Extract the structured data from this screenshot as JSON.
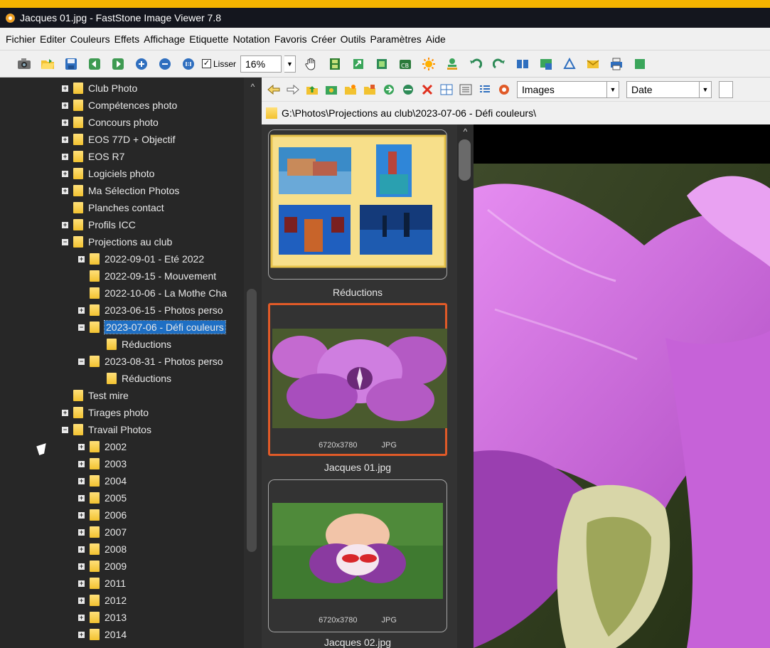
{
  "window": {
    "title": "Jacques 01.jpg  -  FastStone Image Viewer 7.8"
  },
  "menu": [
    "Fichier",
    "Editer",
    "Couleurs",
    "Effets",
    "Affichage",
    "Etiquette",
    "Notation",
    "Favoris",
    "Créer",
    "Outils",
    "Paramètres",
    "Aide"
  ],
  "toolbar": {
    "smooth_label": "Lisser",
    "smooth_checked": "✓",
    "zoom_value": "16%"
  },
  "tree": {
    "items": [
      {
        "label": "Club Photo"
      },
      {
        "label": "Compétences photo"
      },
      {
        "label": "Concours photo"
      },
      {
        "label": "EOS 77D + Objectif"
      },
      {
        "label": "EOS R7"
      },
      {
        "label": "Logiciels photo"
      },
      {
        "label": "Ma Sélection Photos"
      },
      {
        "label": "Planches contact"
      },
      {
        "label": "Profils ICC"
      },
      {
        "label": "Projections au club"
      },
      {
        "label": "2022-09-01 - Eté 2022"
      },
      {
        "label": "2022-09-15 - Mouvement"
      },
      {
        "label": "2022-10-06 - La Mothe Cha"
      },
      {
        "label": "2023-06-15 - Photos perso"
      },
      {
        "label": "2023-07-06 - Défi couleurs"
      },
      {
        "label": "Réductions"
      },
      {
        "label": "2023-08-31 - Photos perso"
      },
      {
        "label": "Réductions"
      },
      {
        "label": "Test mire"
      },
      {
        "label": "Tirages photo"
      },
      {
        "label": "Travail Photos"
      },
      {
        "label": "2002"
      },
      {
        "label": "2003"
      },
      {
        "label": "2004"
      },
      {
        "label": "2005"
      },
      {
        "label": "2006"
      },
      {
        "label": "2007"
      },
      {
        "label": "2008"
      },
      {
        "label": "2009"
      },
      {
        "label": "2011"
      },
      {
        "label": "2012"
      },
      {
        "label": "2013"
      },
      {
        "label": "2014"
      }
    ]
  },
  "browser": {
    "filter_value": "Images",
    "sort_value": "Date",
    "path": "G:\\Photos\\Projections au club\\2023-07-06 - Défi couleurs\\"
  },
  "thumbnails": [
    {
      "caption": "Réductions"
    },
    {
      "caption": "Jacques 01.jpg",
      "dimensions": "6720x3780",
      "format": "JPG"
    },
    {
      "caption": "Jacques 02.jpg",
      "dimensions": "6720x3780",
      "format": "JPG"
    }
  ],
  "colors": {
    "accent_banner": "#f5b400",
    "selection_border": "#e05a28",
    "tree_selection": "#1e6fc4"
  }
}
